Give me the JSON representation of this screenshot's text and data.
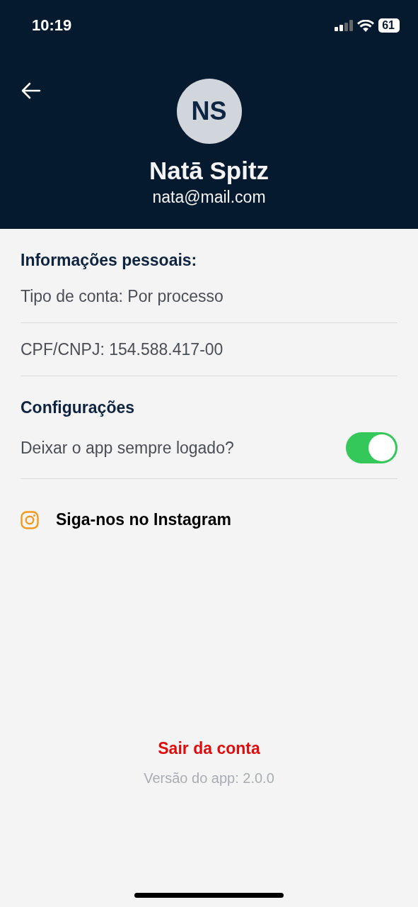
{
  "status_bar": {
    "time": "10:19",
    "battery": "61"
  },
  "header": {
    "avatar_initials": "NS",
    "name": "Natā Spitz",
    "email": "nata@mail.com"
  },
  "personal_info": {
    "title": "Informações pessoais:",
    "rows": [
      "Tipo de conta: Por processo",
      "CPF/CNPJ: 154.588.417-00"
    ]
  },
  "settings": {
    "title": "Configurações",
    "items": [
      {
        "label": "Deixar o app sempre logado?",
        "on": true
      }
    ]
  },
  "instagram_link": "Siga-nos no Instagram",
  "logout": "Sair da conta",
  "version": "Versão do app: 2.0.0"
}
